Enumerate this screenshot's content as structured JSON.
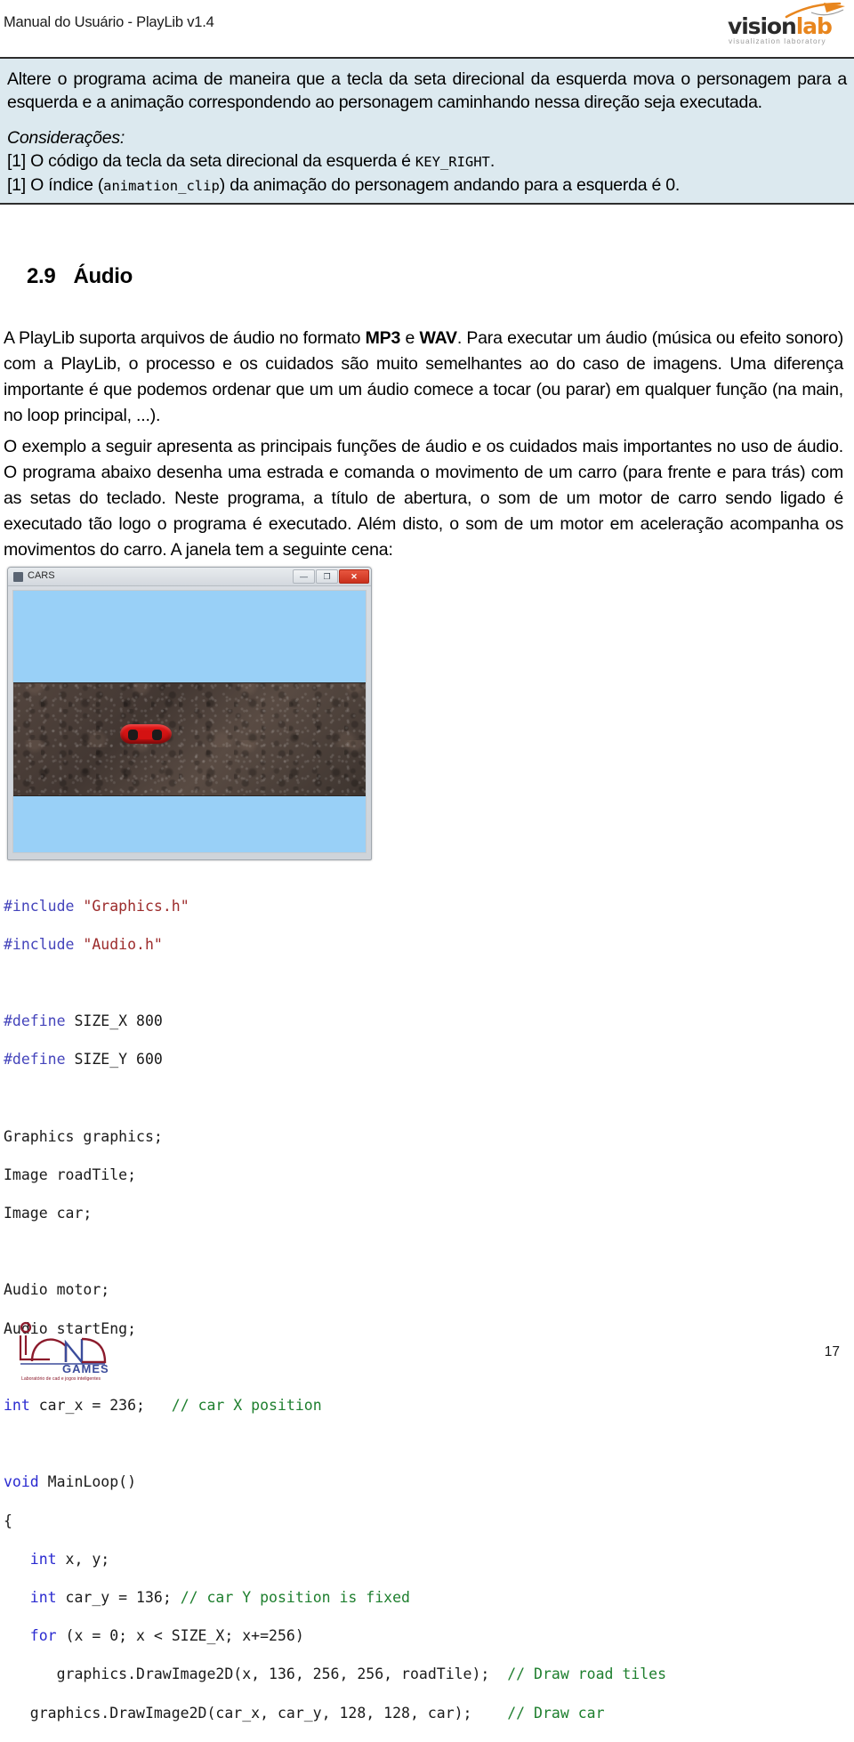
{
  "header": {
    "title": "Manual do Usuário - PlayLib v1.4",
    "logo": {
      "name_part1": "vision",
      "name_part2": "lab",
      "subtitle": "visualization laboratory",
      "color_primary": "#2b2b2b",
      "color_accent": "#E8861E"
    }
  },
  "exercise_box": {
    "background_color": "#DCE9EF",
    "paragraph_1": "Altere o programa acima de maneira que a tecla da seta direcional da esquerda mova o personagem para a esquerda e a animação correspondendo ao personagem caminhando nessa direção seja executada.",
    "considerations_label": "Considerações:",
    "item_1_pre": "[1] O código da tecla da seta direcional da esquerda é ",
    "item_1_code": "KEY_RIGHT",
    "item_1_post": ".",
    "item_2_pre": "[1] O índice (",
    "item_2_code": "animation_clip",
    "item_2_post": ") da animação do personagem andando para a esquerda é 0."
  },
  "section": {
    "number": "2.9",
    "title": "Áudio"
  },
  "paragraphs": {
    "p1_a": "A PlayLib suporta arquivos de áudio no formato ",
    "p1_b1": "MP3",
    "p1_c": " e ",
    "p1_b2": "WAV",
    "p1_d": ". Para executar um áudio (música ou efeito sonoro) com a PlayLib, o processo e os cuidados são muito semelhantes ao do caso de imagens. Uma diferença importante é que podemos ordenar que um um áudio comece a tocar (ou parar) em qualquer função (na main, no loop principal, ...).",
    "p2": "O exemplo a seguir apresenta as principais funções de áudio e os cuidados mais importantes no uso de áudio. O programa abaixo desenha uma estrada e comanda o movimento de um carro (para frente e para trás) com as setas do teclado. Neste programa, a título de abertura, o som de um motor de carro sendo ligado é executado tão logo o programa é executado. Além disto, o som de um motor em aceleração acompanha os movimentos do carro. A janela tem a seguinte cena:"
  },
  "app_window": {
    "title": "CARS",
    "minimize_glyph": "—",
    "maximize_glyph": "❐",
    "close_glyph": "✕",
    "sky_color": "#99D0F7",
    "road_color": "#4a3f3a",
    "car_color": "#e81717"
  },
  "code": {
    "l1_pp": "#include",
    "l1_str": " \"Graphics.h\"",
    "l2_pp": "#include",
    "l2_str": " \"Audio.h\"",
    "l3_pp": "#define",
    "l3_rest": " SIZE_X 800",
    "l4_pp": "#define",
    "l4_rest": " SIZE_Y 600",
    "l5": "Graphics graphics;",
    "l6": "Image roadTile;",
    "l7": "Image car;",
    "l8": "Audio motor;",
    "l9": "Audio startEng;",
    "l10_kw": "int",
    "l10_rest": " car_x = 236;   ",
    "l10_cmt": "// car X position",
    "l11_kw": "void",
    "l11_rest": " MainLoop()",
    "l12": "{",
    "l13_kw": "   int",
    "l13_rest": " x, y;",
    "l14_kw": "   int",
    "l14_rest": " car_y = 136; ",
    "l14_cmt": "// car Y position is fixed",
    "l15_kw": "   for",
    "l15_rest": " (x = 0; x < SIZE_X; x+=256)",
    "l16": "      graphics.DrawImage2D(x, 136, 256, 256, roadTile);  ",
    "l16_cmt": "// Draw road tiles",
    "l17": "   graphics.DrawImage2D(car_x, car_y, 128, 128, car);    ",
    "l17_cmt": "// Draw car"
  },
  "footer": {
    "logo_text": "GAMES",
    "logo_letters": "iCAD",
    "logo_tagline": "Laboratório de cad e jogos inteligentes",
    "page_number": "17"
  }
}
